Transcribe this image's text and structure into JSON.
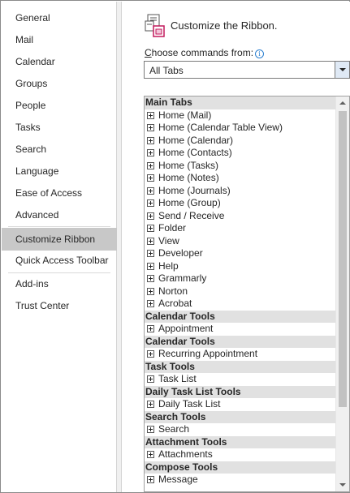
{
  "sidebar": {
    "items": [
      {
        "label": "General"
      },
      {
        "label": "Mail"
      },
      {
        "label": "Calendar"
      },
      {
        "label": "Groups"
      },
      {
        "label": "People"
      },
      {
        "label": "Tasks"
      },
      {
        "label": "Search"
      },
      {
        "label": "Language"
      },
      {
        "label": "Ease of Access"
      },
      {
        "label": "Advanced"
      },
      {
        "label": "Customize Ribbon",
        "selected": true
      },
      {
        "label": "Quick Access Toolbar"
      },
      {
        "label": "Add-ins"
      },
      {
        "label": "Trust Center"
      }
    ]
  },
  "header": {
    "title": "Customize the Ribbon.",
    "icon": "customize-ribbon-icon"
  },
  "commands": {
    "label_prefix": "C",
    "label_rest": "hoose commands from:",
    "info_glyph": "i",
    "selected": "All Tabs"
  },
  "tree": {
    "rows": [
      {
        "type": "group",
        "label": "Main Tabs"
      },
      {
        "type": "tab",
        "label": "Home (Mail)"
      },
      {
        "type": "tab",
        "label": "Home (Calendar Table View)"
      },
      {
        "type": "tab",
        "label": "Home (Calendar)"
      },
      {
        "type": "tab",
        "label": "Home (Contacts)"
      },
      {
        "type": "tab",
        "label": "Home (Tasks)"
      },
      {
        "type": "tab",
        "label": "Home (Notes)"
      },
      {
        "type": "tab",
        "label": "Home (Journals)"
      },
      {
        "type": "tab",
        "label": "Home (Group)"
      },
      {
        "type": "tab",
        "label": "Send / Receive"
      },
      {
        "type": "tab",
        "label": "Folder"
      },
      {
        "type": "tab",
        "label": "View"
      },
      {
        "type": "tab",
        "label": "Developer"
      },
      {
        "type": "tab",
        "label": "Help"
      },
      {
        "type": "tab",
        "label": "Grammarly"
      },
      {
        "type": "tab",
        "label": "Norton"
      },
      {
        "type": "tab",
        "label": "Acrobat"
      },
      {
        "type": "group",
        "label": "Calendar Tools"
      },
      {
        "type": "tab",
        "label": "Appointment"
      },
      {
        "type": "group",
        "label": "Calendar Tools"
      },
      {
        "type": "tab",
        "label": "Recurring Appointment"
      },
      {
        "type": "group",
        "label": "Task Tools"
      },
      {
        "type": "tab",
        "label": "Task List"
      },
      {
        "type": "group",
        "label": "Daily Task List Tools"
      },
      {
        "type": "tab",
        "label": "Daily Task List"
      },
      {
        "type": "group",
        "label": "Search Tools"
      },
      {
        "type": "tab",
        "label": "Search"
      },
      {
        "type": "group",
        "label": "Attachment Tools"
      },
      {
        "type": "tab",
        "label": "Attachments"
      },
      {
        "type": "group",
        "label": "Compose Tools"
      },
      {
        "type": "tab",
        "label": "Message"
      }
    ]
  },
  "colors": {
    "selected_nav": "#c8c8c8",
    "group_header": "#e1e1e1",
    "info_icon": "#2b7fd0",
    "ribbon_icon_accent": "#c2185b"
  }
}
